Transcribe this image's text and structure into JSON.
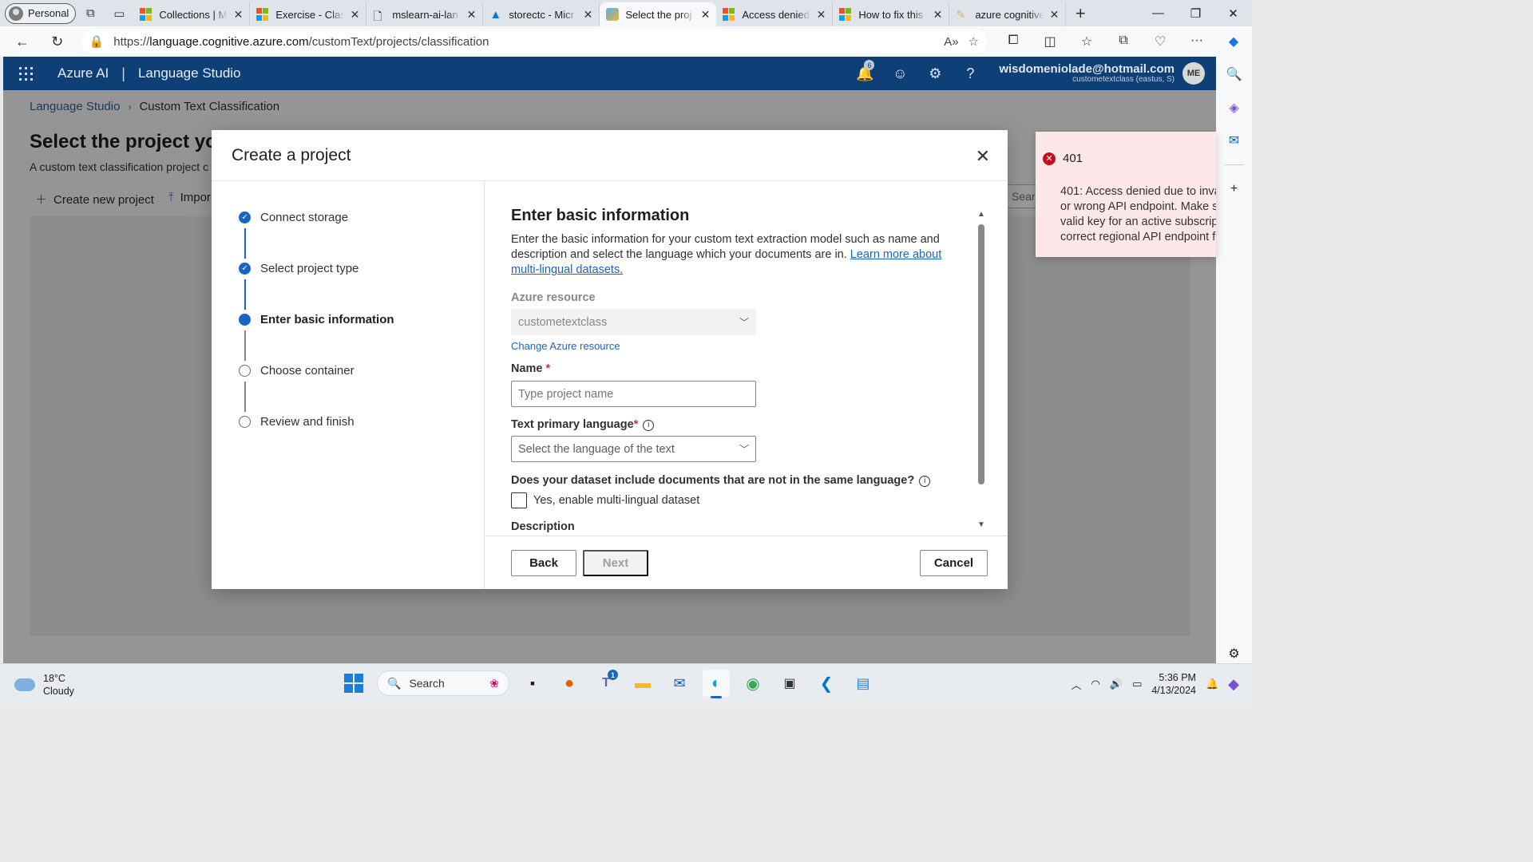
{
  "browser": {
    "profile_label": "Personal",
    "tabs": [
      {
        "title": "Collections | M",
        "active": false
      },
      {
        "title": "Exercise - Clas",
        "active": false
      },
      {
        "title": "mslearn-ai-lan",
        "active": false
      },
      {
        "title": "storectc - Micr",
        "active": false
      },
      {
        "title": "Select the proj",
        "active": true
      },
      {
        "title": "Access denied",
        "active": false
      },
      {
        "title": "How to fix this",
        "active": false
      },
      {
        "title": "azure cognitive",
        "active": false
      }
    ],
    "url_prefix": "https://",
    "url_host": "language.cognitive.azure.com",
    "url_path": "/customText/projects/classification"
  },
  "header": {
    "brand": "Azure AI",
    "product": "Language Studio",
    "notification_count": "6",
    "account_email": "wisdomeniolade@hotmail.com",
    "account_sub": "custometextclass (eastus, S)",
    "avatar_initials": "ME"
  },
  "page": {
    "breadcrumb_root": "Language Studio",
    "breadcrumb_current": "Custom Text Classification",
    "title": "Select the project yo",
    "subtitle": "A custom text classification project c",
    "create_label": "Create new project",
    "import_label": "Impor",
    "search_peek": "Searc"
  },
  "dialog": {
    "title": "Create a project",
    "steps": [
      {
        "label": "Connect storage",
        "state": "done"
      },
      {
        "label": "Select project type",
        "state": "done"
      },
      {
        "label": "Enter basic information",
        "state": "current"
      },
      {
        "label": "Choose container",
        "state": "todo"
      },
      {
        "label": "Review and finish",
        "state": "todo"
      }
    ],
    "section_title": "Enter basic information",
    "intro_text": "Enter the basic information for your custom text extraction model such as name and description and select the language which your documents are in.",
    "intro_link": "Learn more about multi-lingual datasets.",
    "resource_label": "Azure resource",
    "resource_value": "custometextclass",
    "change_resource_link": "Change Azure resource",
    "name_label": "Name",
    "name_placeholder": "Type project name",
    "language_label": "Text primary language",
    "language_placeholder": "Select the language of the text",
    "multilingual_question": "Does your dataset include documents that are not in the same language?",
    "multilingual_checkbox": "Yes, enable multi-lingual dataset",
    "description_label": "Description",
    "back_label": "Back",
    "next_label": "Next",
    "cancel_label": "Cancel"
  },
  "toast": {
    "code": "401",
    "message_lines": [
      "401: Access denied due to inva",
      "or wrong API endpoint. Make s",
      "valid key for an active subscripti",
      "correct regional API endpoint fo"
    ]
  },
  "taskbar": {
    "temperature": "18°C",
    "condition": "Cloudy",
    "search_label": "Search",
    "teams_badge": "1",
    "time": "5:36 PM",
    "date": "4/13/2024"
  }
}
